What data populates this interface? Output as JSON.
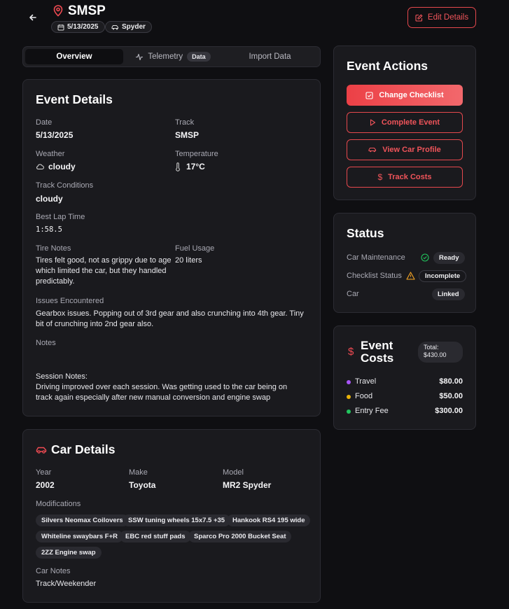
{
  "header": {
    "title": "SMSP",
    "date_badge": "5/13/2025",
    "car_badge": "Spyder",
    "edit_label": "Edit Details"
  },
  "tabs": {
    "overview": "Overview",
    "telemetry": "Telemetry",
    "telemetry_badge": "Data",
    "import": "Import Data"
  },
  "event_details": {
    "title": "Event Details",
    "date_label": "Date",
    "date": "5/13/2025",
    "track_label": "Track",
    "track": "SMSP",
    "weather_label": "Weather",
    "weather": "cloudy",
    "temperature_label": "Temperature",
    "temperature": "17°C",
    "conditions_label": "Track Conditions",
    "conditions": "cloudy",
    "best_lap_label": "Best Lap Time",
    "best_lap": "1:58.5",
    "tire_notes_label": "Tire Notes",
    "tire_notes": "Tires felt good, not as grippy due to age which limited the car, but they handled predictably.",
    "fuel_label": "Fuel Usage",
    "fuel": "20 liters",
    "issues_label": "Issues Encountered",
    "issues": "Gearbox issues. Popping out of 3rd gear and also crunching into 4th gear. Tiny bit of crunching into 2nd gear also.",
    "notes_label": "Notes",
    "session_notes_heading": "Session Notes:",
    "session_notes": "Driving improved over each session. Was getting used to the car being on track again especially after new manual conversion and engine swap"
  },
  "car_details": {
    "title": "Car Details",
    "year_label": "Year",
    "year": "2002",
    "make_label": "Make",
    "make": "Toyota",
    "model_label": "Model",
    "model": "MR2 Spyder",
    "mods_label": "Modifications",
    "modifications": [
      "Silvers Neomax Coilovers",
      "SSW tuning wheels 15x7.5 +35",
      "Hankook RS4 195 wide",
      "Whiteline swaybars F+R",
      "EBC red stuff pads",
      "Sparco Pro 2000 Bucket Seat",
      "2ZZ Engine swap"
    ],
    "notes_label": "Car Notes",
    "notes": "Track/Weekender"
  },
  "event_actions": {
    "title": "Event Actions",
    "change_checklist": "Change Checklist",
    "complete_event": "Complete Event",
    "view_car_profile": "View Car Profile",
    "track_costs": "Track Costs"
  },
  "status": {
    "title": "Status",
    "maintenance_label": "Car Maintenance",
    "maintenance_value": "Ready",
    "checklist_label": "Checklist Status",
    "checklist_value": "Incomplete",
    "car_label": "Car",
    "car_value": "Linked"
  },
  "costs": {
    "title_line1": "Event",
    "title_line2": "Costs",
    "total_label": "Total:",
    "total_value": "$430.00",
    "items": [
      {
        "label": "Travel",
        "value": "$80.00",
        "color": "#a855f7"
      },
      {
        "label": "Food",
        "value": "$50.00",
        "color": "#eab308"
      },
      {
        "label": "Entry Fee",
        "value": "$300.00",
        "color": "#22c55e"
      }
    ]
  },
  "colors": {
    "accent": "#ef4a52",
    "success": "#22c55e",
    "warning": "#f5a524"
  }
}
